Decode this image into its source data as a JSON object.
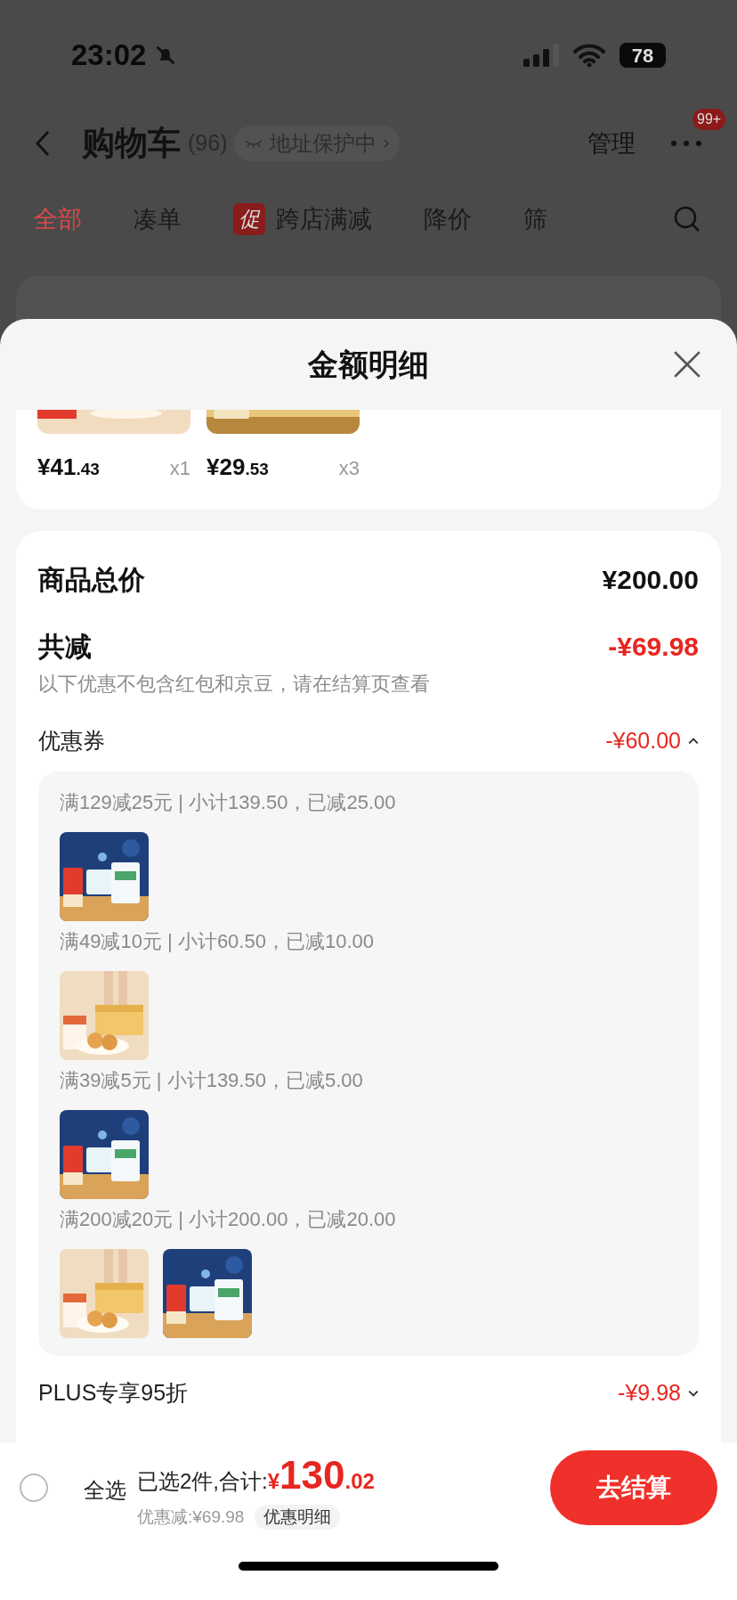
{
  "status_bar": {
    "time": "23:02",
    "battery": "78"
  },
  "header": {
    "title": "购物车",
    "count": "(96)",
    "address_chip": "地址保护中",
    "manage": "管理",
    "more_badge": "99+"
  },
  "tabs": [
    {
      "label": "全部",
      "selected": true
    },
    {
      "label": "凑单",
      "selected": false
    },
    {
      "label": "跨店满减",
      "badge": "促",
      "selected": false
    },
    {
      "label": "降价",
      "selected": false
    },
    {
      "label": "筛",
      "selected": false
    }
  ],
  "sheet": {
    "title": "金额明细",
    "products": [
      {
        "price": "¥41",
        "price_decimal": ".43",
        "quantity": "x1"
      },
      {
        "price": "¥29",
        "price_decimal": ".53",
        "quantity": "x3"
      }
    ],
    "total": {
      "label": "商品总价",
      "value": "¥200.00"
    },
    "reduction": {
      "label": "共减",
      "value": "-¥69.98",
      "note": "以下优惠不包含红包和京豆，请在结算页查看"
    },
    "discounts": [
      {
        "label": "优惠券",
        "value": "-¥60.00",
        "expanded": true,
        "groups": [
          {
            "rule": "满129减25元 | 小计139.50，已减25.00"
          },
          {
            "rule": "满49减10元 | 小计60.50，已减10.00"
          },
          {
            "rule": "满39减5元 | 小计139.50，已减5.00"
          },
          {
            "rule": "满200减20元 | 小计200.00，已减20.00"
          }
        ]
      },
      {
        "label": "PLUS专享95折",
        "value": "-¥9.98",
        "expanded": false
      }
    ]
  },
  "bottom_bar": {
    "select_all": {
      "label": "全选",
      "checked": false
    },
    "summary": "已选2件,合计:",
    "currency": "¥",
    "total": "130",
    "total_decimal": ".02",
    "discount": "优惠减:¥69.98",
    "detail_button": "优惠明细",
    "checkout": "去结算"
  }
}
